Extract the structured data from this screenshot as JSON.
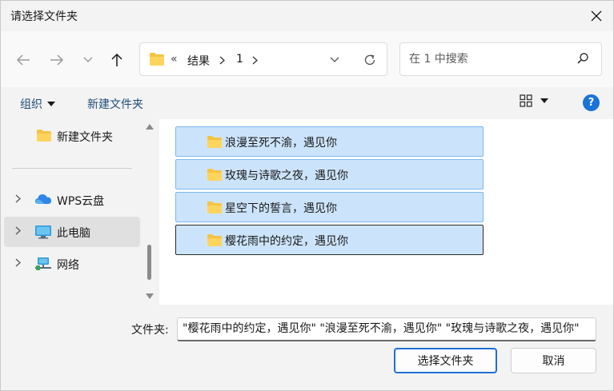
{
  "window": {
    "title": "请选择文件夹"
  },
  "nav": {
    "address": {
      "prefix": "«",
      "crumbs": [
        "结果",
        "1"
      ]
    },
    "search": {
      "placeholder": "在 1 中搜索"
    }
  },
  "commands": {
    "organize": "组织",
    "new_folder": "新建文件夹"
  },
  "sidebar": {
    "items": [
      {
        "label": "新建文件夹",
        "icon": "folder-icon",
        "has_chevron": false,
        "selected": false
      },
      {
        "label": "WPS云盘",
        "icon": "cloud-icon",
        "has_chevron": true,
        "selected": false
      },
      {
        "label": "此电脑",
        "icon": "monitor-icon",
        "has_chevron": true,
        "selected": true
      },
      {
        "label": "网络",
        "icon": "network-icon",
        "has_chevron": true,
        "selected": false
      }
    ]
  },
  "files": [
    {
      "name": "浪漫至死不渝，遇见你",
      "selected": true,
      "focused": false
    },
    {
      "name": "玫瑰与诗歌之夜，遇见你",
      "selected": true,
      "focused": false
    },
    {
      "name": "星空下的誓言，遇见你",
      "selected": true,
      "focused": false
    },
    {
      "name": "樱花雨中的约定，遇见你",
      "selected": true,
      "focused": true
    }
  ],
  "footer": {
    "folder_label": "文件夹:",
    "folder_value": "\"樱花雨中的约定，遇见你\" \"浪漫至死不渝，遇见你\" \"玫瑰与诗歌之夜，遇见你\"",
    "select_button": "选择文件夹",
    "cancel_button": "取消"
  },
  "colors": {
    "accent": "#1f6fd0",
    "selection_bg": "#cce4fb",
    "selection_border": "#7ab8ef",
    "folder": "#f5c343"
  }
}
